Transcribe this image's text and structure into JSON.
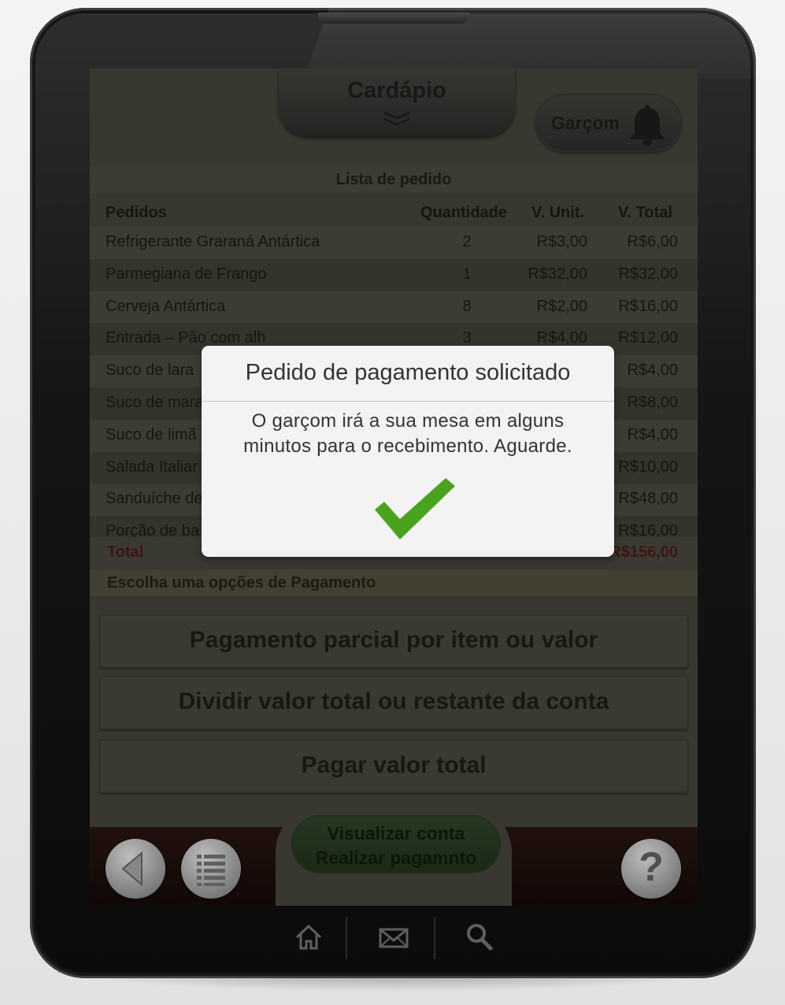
{
  "header": {
    "title": "Cardápio",
    "waiter_label": "Garçom"
  },
  "order_list": {
    "title": "Lista de pedido",
    "columns": {
      "name": "Pedidos",
      "qty": "Quantidade",
      "unit": "V. Unit.",
      "total": "V. Total"
    },
    "rows": [
      {
        "name": "Refrigerante Graraná Antártica",
        "qty": "2",
        "unit": "R$3,00",
        "total": "R$6,00"
      },
      {
        "name": "Parmegiana de Frango",
        "qty": "1",
        "unit": "R$32,00",
        "total": "R$32,00"
      },
      {
        "name": "Cerveja Antártica",
        "qty": "8",
        "unit": "R$2,00",
        "total": "R$16,00"
      },
      {
        "name": "Entrada – Pão com alh",
        "qty": "3",
        "unit": "R$4,00",
        "total": "R$12,00"
      },
      {
        "name": "Suco de lara",
        "qty": "",
        "unit": "",
        "total": "R$4,00"
      },
      {
        "name": "Suco de mara",
        "qty": "",
        "unit": "",
        "total": "R$8,00"
      },
      {
        "name": "Suco de limã",
        "qty": "",
        "unit": "",
        "total": "R$4,00"
      },
      {
        "name": "Salada Italiar",
        "qty": "",
        "unit": "",
        "total": "R$10,00"
      },
      {
        "name": "Sanduíche de",
        "qty": "",
        "unit": "",
        "total": "R$48,00"
      },
      {
        "name": "Porção de ba",
        "qty": "",
        "unit": "",
        "total": "R$16,00"
      }
    ],
    "total_label": "Total",
    "total_value": "R$156,00"
  },
  "payment": {
    "title": "Escolha uma opções de Pagamento",
    "options": [
      "Pagamento parcial por item ou valor",
      "Dividir valor total ou restante da conta",
      "Pagar valor total"
    ]
  },
  "bottom": {
    "view_line1": "Visualizar conta",
    "view_line2": "Realizar pagamnto",
    "help_label": "?"
  },
  "modal": {
    "title": "Pedido de pagamento solicitado",
    "message": "O garçom irá a sua mesa em alguns minutos para o recebimento. Aguarde."
  },
  "icons": {
    "back": "triangle-left-icon",
    "menu": "list-icon",
    "help": "question-icon",
    "bell": "bell-icon",
    "home": "home-icon",
    "mail": "mail-icon",
    "search": "search-icon",
    "check": "checkmark-icon"
  },
  "colors": {
    "check": "#4aa31e",
    "total_text": "#4a1616",
    "modal_bg": "#f3f3f3"
  }
}
